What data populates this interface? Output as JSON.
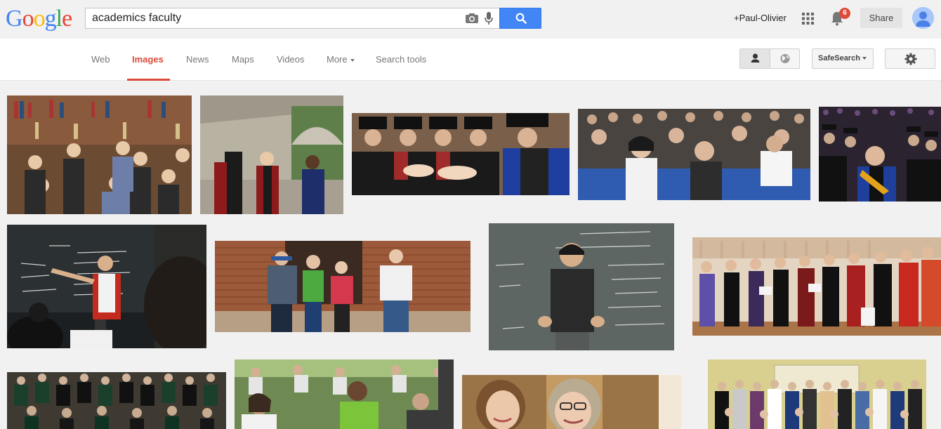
{
  "header": {
    "logo_letters": [
      {
        "ch": "G",
        "color": "#4285f4"
      },
      {
        "ch": "o",
        "color": "#ea4335"
      },
      {
        "ch": "o",
        "color": "#fbbc05"
      },
      {
        "ch": "g",
        "color": "#4285f4"
      },
      {
        "ch": "l",
        "color": "#34a853"
      },
      {
        "ch": "e",
        "color": "#ea4335"
      }
    ],
    "search_query": "academics faculty",
    "user_name": "+Paul-Olivier",
    "notification_count": "6",
    "share_label": "Share"
  },
  "nav": {
    "tabs": [
      {
        "label": "Web"
      },
      {
        "label": "Images"
      },
      {
        "label": "News"
      },
      {
        "label": "Maps"
      },
      {
        "label": "Videos"
      },
      {
        "label": "More"
      },
      {
        "label": "Search tools"
      }
    ],
    "active_tab": "Images",
    "safesearch_label": "SafeSearch"
  },
  "colors": {
    "accent_red": "#dd4b39",
    "search_blue": "#4285f4"
  },
  "results": [
    {
      "alt": "faculty group in library"
    },
    {
      "alt": "faculty procession in cloister"
    },
    {
      "alt": "graduates shaking hands with professor"
    },
    {
      "alt": "students in lecture hall"
    },
    {
      "alt": "graduation ceremony crowd"
    },
    {
      "alt": "professor teaching at blackboard"
    },
    {
      "alt": "students walking in hallway"
    },
    {
      "alt": "professor in front of chalkboard"
    },
    {
      "alt": "faculty in academic robes"
    },
    {
      "alt": "graduates in green gowns"
    },
    {
      "alt": "students eating outdoors"
    },
    {
      "alt": "two women smiling"
    },
    {
      "alt": "faculty group photo"
    }
  ]
}
